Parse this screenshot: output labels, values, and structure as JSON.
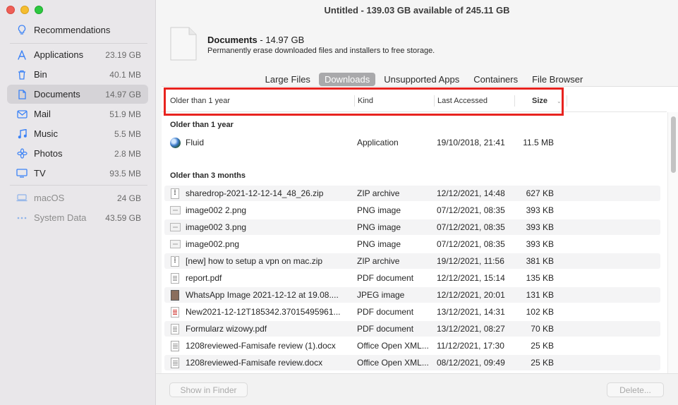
{
  "window": {
    "title": "Untitled - 139.03 GB available of 245.11 GB"
  },
  "colors": {
    "accent": "#3b82f6",
    "highlight_box": "#e8231f",
    "active_tab": "#a9a9ab"
  },
  "sidebar": {
    "recommendations": {
      "label": "Recommendations",
      "icon": "lightbulb-icon"
    },
    "items": [
      {
        "label": "Applications",
        "size": "23.19 GB",
        "icon": "applications-icon"
      },
      {
        "label": "Bin",
        "size": "40.1 MB",
        "icon": "bin-icon"
      },
      {
        "label": "Documents",
        "size": "14.97 GB",
        "icon": "document-icon",
        "selected": true
      },
      {
        "label": "Mail",
        "size": "51.9 MB",
        "icon": "mail-icon"
      },
      {
        "label": "Music",
        "size": "5.5 MB",
        "icon": "music-icon"
      },
      {
        "label": "Photos",
        "size": "2.8 MB",
        "icon": "photos-icon"
      },
      {
        "label": "TV",
        "size": "93.5 MB",
        "icon": "tv-icon"
      }
    ],
    "system": [
      {
        "label": "macOS",
        "size": "24 GB",
        "icon": "macos-icon"
      },
      {
        "label": "System Data",
        "size": "43.59 GB",
        "icon": "ellipsis-icon"
      }
    ]
  },
  "header": {
    "title": "Documents",
    "size": "14.97 GB",
    "separator": " - ",
    "description": "Permanently erase downloaded files and installers to free storage."
  },
  "tabs": [
    {
      "label": "Large Files",
      "active": false
    },
    {
      "label": "Downloads",
      "active": true
    },
    {
      "label": "Unsupported Apps",
      "active": false
    },
    {
      "label": "Containers",
      "active": false
    },
    {
      "label": "File Browser",
      "active": false
    }
  ],
  "columns": {
    "name": "Older than 1 year",
    "kind": "Kind",
    "last_accessed": "Last Accessed",
    "size": "Size"
  },
  "groups": [
    {
      "title": "Older than 1 year",
      "rows": [
        {
          "name": "Fluid",
          "kind": "Application",
          "date": "19/10/2018, 21:41",
          "size": "11.5 MB",
          "icon": "app"
        }
      ]
    },
    {
      "title": "Older than 3 months",
      "rows": [
        {
          "name": "sharedrop-2021-12-12-14_48_26.zip",
          "kind": "ZIP archive",
          "date": "12/12/2021, 14:48",
          "size": "627 KB",
          "icon": "zip"
        },
        {
          "name": "image002 2.png",
          "kind": "PNG image",
          "date": "07/12/2021, 08:35",
          "size": "393 KB",
          "icon": "img"
        },
        {
          "name": "image002 3.png",
          "kind": "PNG image",
          "date": "07/12/2021, 08:35",
          "size": "393 KB",
          "icon": "img"
        },
        {
          "name": "image002.png",
          "kind": "PNG image",
          "date": "07/12/2021, 08:35",
          "size": "393 KB",
          "icon": "img"
        },
        {
          "name": "[new] how to setup a vpn on mac.zip",
          "kind": "ZIP archive",
          "date": "19/12/2021, 11:56",
          "size": "381 KB",
          "icon": "zip"
        },
        {
          "name": "report.pdf",
          "kind": "PDF document",
          "date": "12/12/2021, 15:14",
          "size": "135 KB",
          "icon": "pdf"
        },
        {
          "name": "WhatsApp Image 2021-12-12 at 19.08....",
          "kind": "JPEG image",
          "date": "12/12/2021, 20:01",
          "size": "131 KB",
          "icon": "jpg"
        },
        {
          "name": "New2021-12-12T185342.37015495961...",
          "kind": "PDF document",
          "date": "13/12/2021, 14:31",
          "size": "102 KB",
          "icon": "pdf-red"
        },
        {
          "name": "Formularz wizowy.pdf",
          "kind": "PDF document",
          "date": "13/12/2021, 08:27",
          "size": "70 KB",
          "icon": "pdf"
        },
        {
          "name": "1208reviewed-Famisafe review (1).docx",
          "kind": "Office Open XML...",
          "date": "11/12/2021, 17:30",
          "size": "25 KB",
          "icon": "doc"
        },
        {
          "name": "1208reviewed-Famisafe review.docx",
          "kind": "Office Open XML...",
          "date": "08/12/2021, 09:49",
          "size": "25 KB",
          "icon": "doc"
        }
      ]
    }
  ],
  "footer": {
    "show_in_finder": "Show in Finder",
    "delete": "Delete..."
  }
}
